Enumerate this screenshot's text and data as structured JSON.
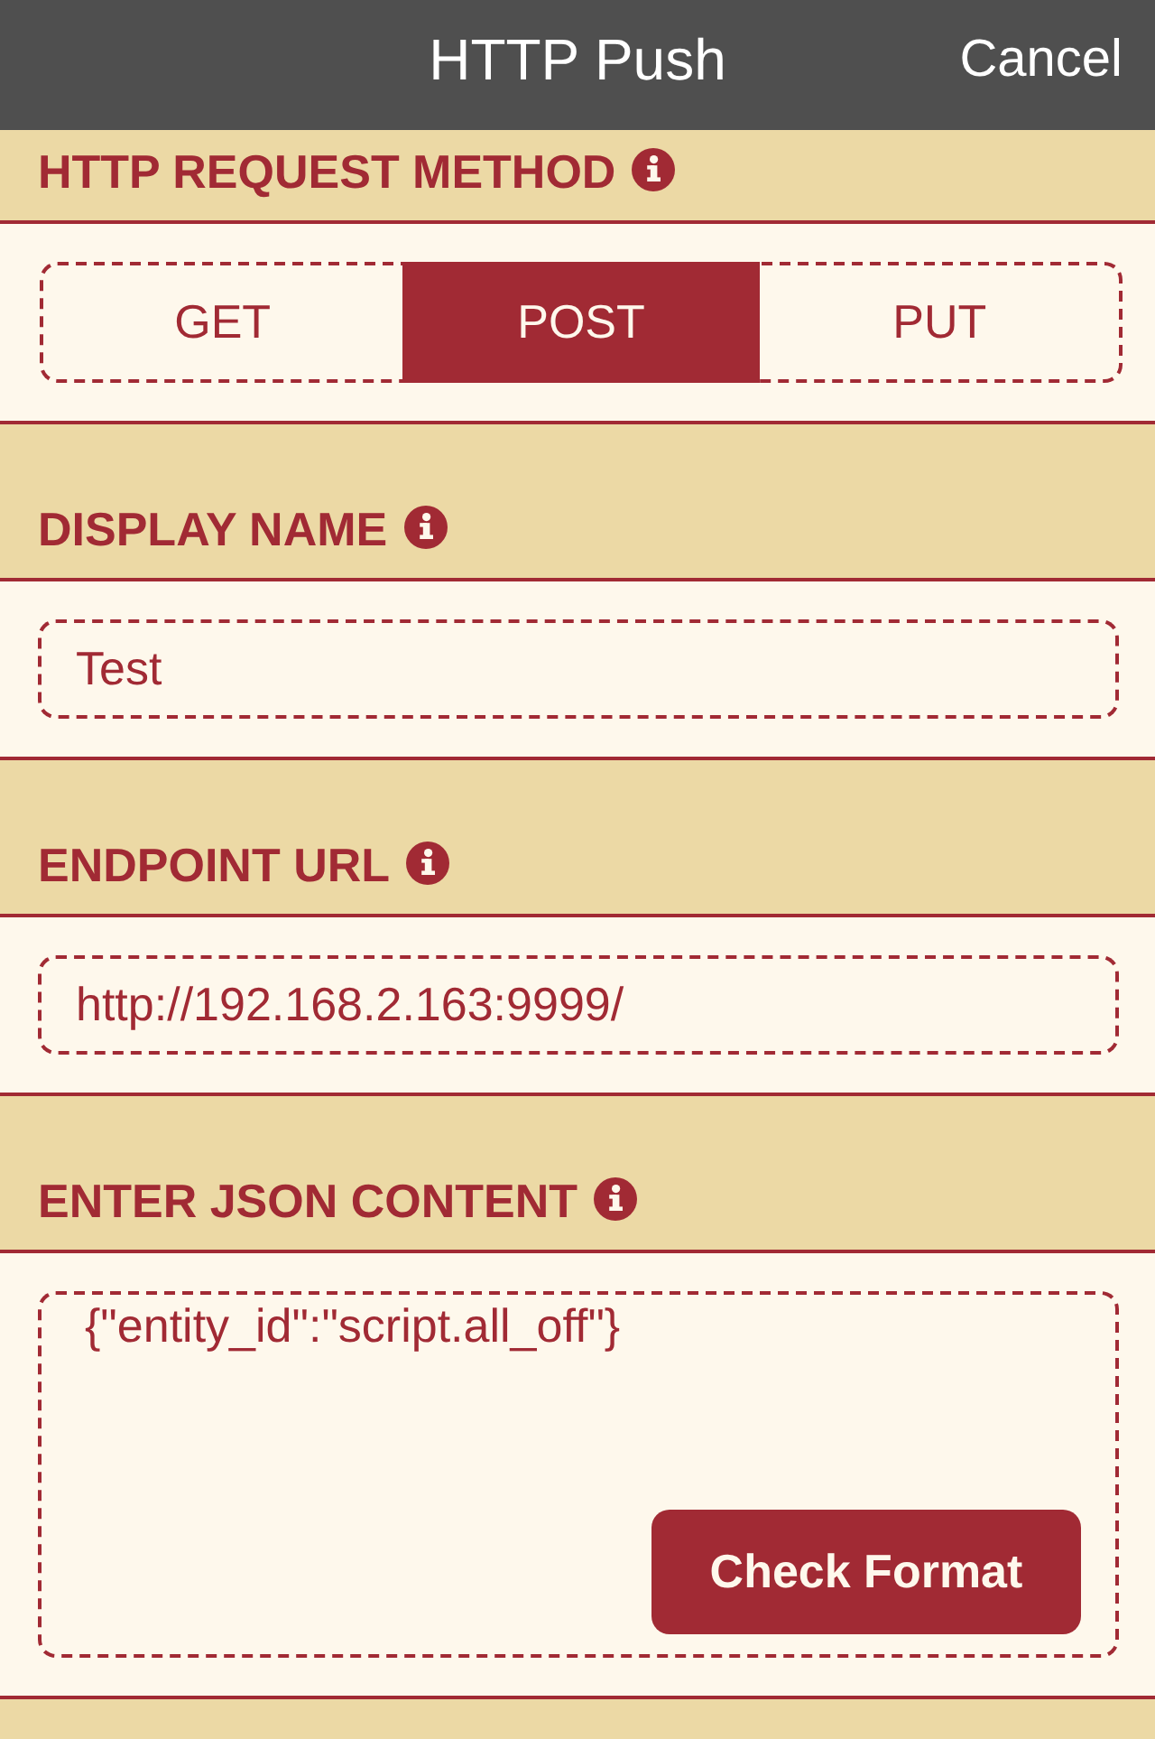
{
  "nav": {
    "title": "HTTP Push",
    "cancel": "Cancel"
  },
  "sections": [
    {
      "kind": "segmented",
      "label": "HTTP REQUEST METHOD",
      "options": [
        {
          "label": "GET",
          "selected": false
        },
        {
          "label": "POST",
          "selected": true
        },
        {
          "label": "PUT",
          "selected": false
        }
      ]
    },
    {
      "kind": "text",
      "label": "DISPLAY NAME",
      "value": "Test"
    },
    {
      "kind": "text",
      "label": "ENDPOINT URL",
      "value": "http://192.168.2.163:9999/"
    },
    {
      "kind": "json",
      "label": "ENTER JSON CONTENT",
      "value": "{\"entity_id\":\"script.all_off\"}",
      "button": "Check Format"
    }
  ]
}
